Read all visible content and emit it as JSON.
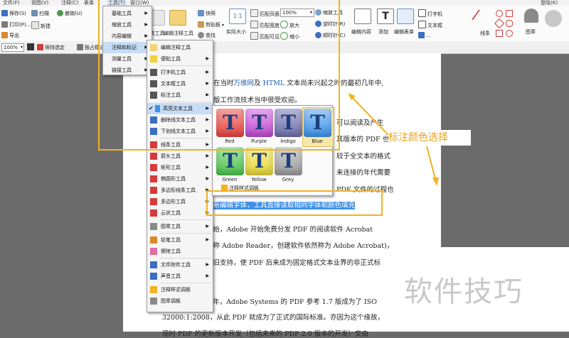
{
  "menubar": {
    "items": [
      "文件(F)",
      "视图(V)",
      "注释(C)",
      "表单",
      "工具(T)",
      "窗口(W)"
    ],
    "right": "登陆(K)"
  },
  "ribbon": {
    "left_buttons": [
      {
        "label": "保存(S)",
        "icon": "save-icon"
      },
      {
        "label": "扫描",
        "icon": "scan-icon"
      },
      {
        "label": "撤销(U)",
        "icon": "undo-icon"
      },
      {
        "label": "打印(P)...",
        "icon": "print-icon"
      },
      {
        "label": "新建",
        "icon": "new-doc-icon"
      },
      {
        "label": "导出",
        "icon": "export-icon"
      }
    ],
    "mid_buttons": [
      {
        "label": "快照",
        "icon": "snapshot-icon"
      },
      {
        "label": "剪贴板",
        "icon": "clipboard-icon"
      },
      {
        "label": "查找",
        "icon": "find-icon"
      }
    ],
    "large": [
      {
        "label": "..放工具",
        "icon": "zoom-tool-icon"
      },
      {
        "label": "编辑注释工具",
        "icon": "edit-annotation-icon"
      },
      {
        "label": "实际大小",
        "icon": "actual-size-icon"
      }
    ],
    "zoom_group": [
      {
        "label": "匹配页面",
        "icon": "fit-page-icon"
      },
      {
        "label": "匹配宽度",
        "icon": "fit-width-icon"
      },
      {
        "label": "匹配可见",
        "icon": "fit-visible-icon"
      }
    ],
    "zoom_value": "100%",
    "zoom_ops": [
      {
        "label": "缩放工具",
        "icon": "zoom-icon"
      },
      {
        "label": "放大",
        "icon": "zoom-in-icon"
      },
      {
        "label": "缩小",
        "icon": "zoom-out-icon"
      },
      {
        "label": "逆时针(R)",
        "icon": "rotate-ccw-icon"
      },
      {
        "label": "顺时针(C)",
        "icon": "rotate-cw-icon"
      }
    ],
    "right_large": [
      {
        "label": "编辑内容",
        "icon": "edit-content-icon"
      },
      {
        "label": "添加",
        "icon": "add-text-icon"
      },
      {
        "label": "编辑表单",
        "icon": "edit-form-icon"
      }
    ],
    "right_small": [
      {
        "label": "打字机",
        "icon": "typewriter-icon"
      },
      {
        "label": "文本框",
        "icon": "textbox-icon"
      },
      {
        "label": "...",
        "icon": "audio-icon"
      }
    ],
    "shapes_label": "线条",
    "stamp_label": "图章",
    "login_label": "登陆(K)"
  },
  "toolbar2": {
    "zoom": "100%",
    "keep_selected": "保持选定",
    "single_page": "独占模式"
  },
  "tools_menu": {
    "items": [
      {
        "label": "基础工具"
      },
      {
        "label": "缩放工具"
      },
      {
        "label": "内容编辑"
      },
      {
        "label": "注释和标记",
        "active": true
      },
      {
        "label": "测量工具"
      },
      {
        "label": "链接工具"
      }
    ]
  },
  "annot_menu": {
    "items": [
      {
        "label": "编辑注释工具",
        "icon": "edit-annotation-icon",
        "arrow": false
      },
      {
        "label": "便贴工具",
        "icon": "sticky-note-icon",
        "arrow": true
      },
      {
        "label": "打字机工具",
        "icon": "typewriter-icon",
        "arrow": true
      },
      {
        "label": "文本框工具",
        "icon": "textbox-icon",
        "arrow": true
      },
      {
        "label": "标注工具",
        "icon": "callout-icon",
        "arrow": true
      },
      {
        "label": "高亮文本工具",
        "icon": "highlight-icon",
        "arrow": true,
        "active": true,
        "checked": true
      },
      {
        "label": "删除线文本工具",
        "icon": "strikeout-icon",
        "arrow": true
      },
      {
        "label": "下划线文本工具",
        "icon": "underline-icon",
        "arrow": true
      },
      {
        "label": "线条工具",
        "icon": "line-icon",
        "arrow": true
      },
      {
        "label": "箭头工具",
        "icon": "arrow-icon",
        "arrow": true
      },
      {
        "label": "矩形工具",
        "icon": "rectangle-icon",
        "arrow": true
      },
      {
        "label": "椭圆形工具",
        "icon": "ellipse-icon",
        "arrow": true
      },
      {
        "label": "多边形线条工具",
        "icon": "polyline-icon",
        "arrow": true
      },
      {
        "label": "多边形工具",
        "icon": "polygon-icon",
        "arrow": true
      },
      {
        "label": "云状工具",
        "icon": "cloud-icon",
        "arrow": true
      },
      {
        "label": "图章工具",
        "icon": "stamp-icon",
        "arrow": true
      },
      {
        "label": "铅笔工具",
        "icon": "pencil-icon",
        "arrow": true
      },
      {
        "label": "擦除工具",
        "icon": "eraser-icon",
        "arrow": false
      },
      {
        "label": "文件附件工具",
        "icon": "attachment-icon",
        "arrow": true
      },
      {
        "label": "声音工具",
        "icon": "sound-icon",
        "arrow": true
      },
      {
        "label": "注释样式调板",
        "icon": "style-palette-icon",
        "arrow": false
      },
      {
        "label": "图章调板",
        "icon": "stamp-palette-icon",
        "arrow": false
      }
    ]
  },
  "color_palette": {
    "swatches": [
      {
        "label": "Red",
        "color": "#e8443f",
        "light": "#f8a3a0"
      },
      {
        "label": "Purple",
        "color": "#c04ad0",
        "light": "#e9a8f0"
      },
      {
        "label": "Indigo",
        "color": "#6f6faa",
        "light": "#b8b8d8"
      },
      {
        "label": "Blue",
        "color": "#3c93ec",
        "light": "#a6cdf6",
        "selected": true
      },
      {
        "label": "Green",
        "color": "#4cc24c",
        "light": "#a6e6a6"
      },
      {
        "label": "Yellow",
        "color": "#e8d83a",
        "light": "#f6ef9c"
      },
      {
        "label": "Grey",
        "color": "#9c9c9c",
        "light": "#d4d4d4"
      }
    ],
    "footer": "注释样式调板"
  },
  "document": {
    "lines": [
      {
        "pre": "在当时",
        "link1": "万维网",
        "mid": "及",
        "link2": "HTML",
        "post": "文本尚未兴起之时的最初几年中,"
      },
      {
        "text": "版工作流技术当中很受欢迎。"
      },
      {
        "text": "可以阅读及产生"
      },
      {
        "text": "其版本的 PDF 也可"
      },
      {
        "text": "较于全文本的格式"
      },
      {
        "text": "来连接的年代需要"
      },
      {
        "text": "PDF 文件的过程也"
      },
      {
        "highlight": "选新编辑字体，工具直接读取相同字体和颜色填充"
      },
      {
        "text": "开始，Adobe 开始免费分发 PDF 的阅读软件 Acrobat"
      },
      {
        "text": "改称 Adobe Reader，创建软件依然称为 Adobe Acrobat)，"
      },
      {
        "text": "依旧支持，使 PDF 后来成为固定格式文本业界的非正式标"
      },
      {
        "text": "8 年，Adobe Systems 的 PDF 参考 1.7 版成为了 ISO"
      },
      {
        "text": "32000:1:2008，从此 PDF 就成为了正式的国际标准。亦因为这个缘故，"
      },
      {
        "text": "现时 PDF 的更新版本开发（包括未来的 PDF 2.0 版本的开发）交由"
      }
    ]
  },
  "callout": {
    "text": "标注颜色选择"
  },
  "watermark": {
    "text": "软件技巧"
  },
  "colors": {
    "accent": "#f0b323",
    "highlight": "#3d8fe8",
    "link": "#1a5fb4"
  }
}
